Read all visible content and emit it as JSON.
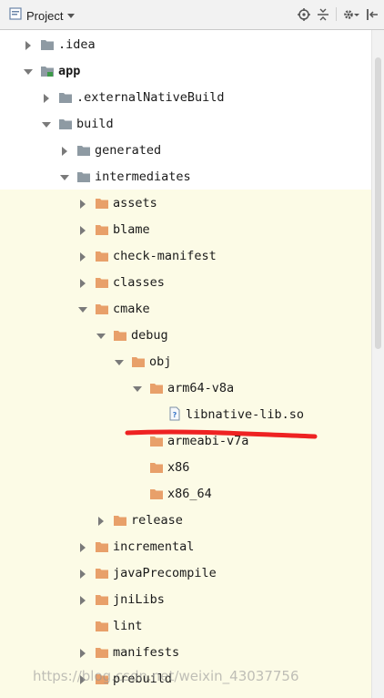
{
  "header": {
    "title": "Project"
  },
  "header_icons": [
    "target-icon",
    "collapse-all-icon",
    "gear-icon",
    "hide-icon"
  ],
  "tree": [
    {
      "label": ".idea",
      "depth": 1,
      "toggle": "collapsed",
      "icon": "folder-gray"
    },
    {
      "label": "app",
      "depth": 1,
      "toggle": "expanded",
      "icon": "module-folder",
      "bold": true
    },
    {
      "label": ".externalNativeBuild",
      "depth": 2,
      "toggle": "collapsed",
      "icon": "folder-gray"
    },
    {
      "label": "build",
      "depth": 2,
      "toggle": "expanded",
      "icon": "folder-gray"
    },
    {
      "label": "generated",
      "depth": 3,
      "toggle": "collapsed",
      "icon": "folder-gray"
    },
    {
      "label": "intermediates",
      "depth": 3,
      "toggle": "expanded",
      "icon": "folder-gray"
    },
    {
      "label": "assets",
      "depth": 4,
      "toggle": "collapsed",
      "icon": "folder-orange"
    },
    {
      "label": "blame",
      "depth": 4,
      "toggle": "collapsed",
      "icon": "folder-orange"
    },
    {
      "label": "check-manifest",
      "depth": 4,
      "toggle": "collapsed",
      "icon": "folder-orange"
    },
    {
      "label": "classes",
      "depth": 4,
      "toggle": "collapsed",
      "icon": "folder-orange"
    },
    {
      "label": "cmake",
      "depth": 4,
      "toggle": "expanded",
      "icon": "folder-orange"
    },
    {
      "label": "debug",
      "depth": 5,
      "toggle": "expanded",
      "icon": "folder-orange"
    },
    {
      "label": "obj",
      "depth": 6,
      "toggle": "expanded",
      "icon": "folder-orange"
    },
    {
      "label": "arm64-v8a",
      "depth": 7,
      "toggle": "expanded",
      "icon": "folder-orange"
    },
    {
      "label": "libnative-lib.so",
      "depth": 8,
      "toggle": "none",
      "icon": "unknown-file"
    },
    {
      "label": "armeabi-v7a",
      "depth": 7,
      "toggle": "none",
      "icon": "folder-orange"
    },
    {
      "label": "x86",
      "depth": 7,
      "toggle": "none",
      "icon": "folder-orange"
    },
    {
      "label": "x86_64",
      "depth": 7,
      "toggle": "none",
      "icon": "folder-orange"
    },
    {
      "label": "release",
      "depth": 5,
      "toggle": "collapsed",
      "icon": "folder-orange"
    },
    {
      "label": "incremental",
      "depth": 4,
      "toggle": "collapsed",
      "icon": "folder-orange"
    },
    {
      "label": "javaPrecompile",
      "depth": 4,
      "toggle": "collapsed",
      "icon": "folder-orange"
    },
    {
      "label": "jniLibs",
      "depth": 4,
      "toggle": "collapsed",
      "icon": "folder-orange"
    },
    {
      "label": "lint",
      "depth": 4,
      "toggle": "none",
      "icon": "folder-orange"
    },
    {
      "label": "manifests",
      "depth": 4,
      "toggle": "collapsed",
      "icon": "folder-orange"
    },
    {
      "label": "prebuild",
      "depth": 4,
      "toggle": "collapsed",
      "icon": "folder-orange"
    }
  ],
  "watermark": "https://blog.csdn.net/weixin_43037756",
  "colors": {
    "folder_gray": "#8e9aa3",
    "folder_orange": "#e8a06a",
    "highlight": "#fcfbe6",
    "annotation": "#ee2222"
  }
}
